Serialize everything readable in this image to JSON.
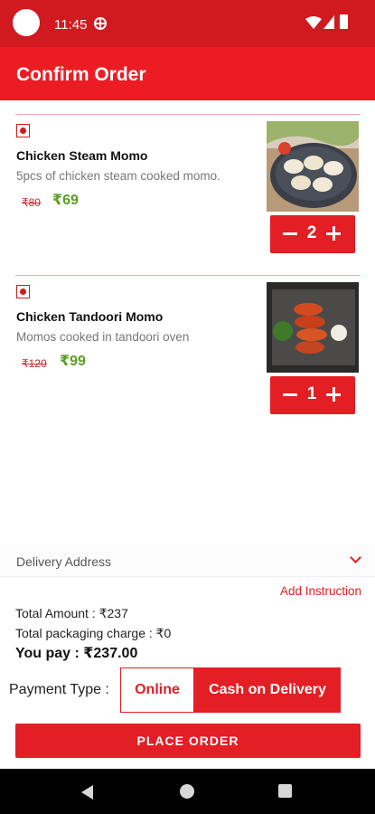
{
  "status_bar": {
    "time": "11:45"
  },
  "header": {
    "title": "Confirm Order"
  },
  "items": [
    {
      "name": "Chicken Steam Momo",
      "description": "5pcs of chicken steam cooked momo.",
      "old_price": "₹80",
      "price": "₹69",
      "quantity": "2"
    },
    {
      "name": "Chicken Tandoori Momo",
      "description": "Momos cooked in tandoori oven",
      "old_price": "₹120",
      "price": "₹99",
      "quantity": "1"
    }
  ],
  "delivery": {
    "label": "Delivery Address"
  },
  "add_instruction": "Add Instruction",
  "summary": {
    "total_amount": "Total Amount : ₹237",
    "packaging": "Total packaging charge : ₹0",
    "you_pay": "You pay : ₹237.00"
  },
  "payment": {
    "label": "Payment Type :",
    "options": [
      "Online",
      "Cash on Delivery"
    ],
    "selected": "Cash on Delivery"
  },
  "place_order_label": "PLACE ORDER",
  "colors": {
    "brand": "#e31e24",
    "status_bar": "#d11a20",
    "price_green": "#5a9e24"
  }
}
